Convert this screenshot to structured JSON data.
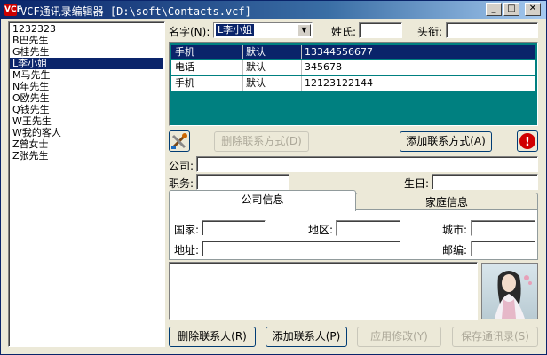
{
  "window": {
    "title": "VCF通讯录编辑器 [D:\\soft\\Contacts.vcf]",
    "app_icon": "VCF"
  },
  "titlebar_buttons": {
    "minimize": "_",
    "maximize": "□",
    "close": "✕"
  },
  "contacts": [
    {
      "label": "1232323"
    },
    {
      "label": "B巴先生"
    },
    {
      "label": "G桂先生"
    },
    {
      "label": "L李小姐",
      "selected": true
    },
    {
      "label": "M马先生"
    },
    {
      "label": "N年先生"
    },
    {
      "label": "O欧先生"
    },
    {
      "label": "Q钱先生"
    },
    {
      "label": "W王先生"
    },
    {
      "label": "W我的客人"
    },
    {
      "label": "Z曾女士"
    },
    {
      "label": "Z张先生"
    }
  ],
  "form": {
    "name_label": "名字(N):",
    "name_value": "L李小姐",
    "surname_label": "姓氏:",
    "surname_value": "",
    "title_label": "头衔:",
    "title_value": "",
    "company_label": "公司:",
    "company_value": "",
    "position_label": "职务:",
    "position_value": "",
    "birthday_label": "生日:",
    "birthday_value": ""
  },
  "phones": [
    {
      "type": "手机",
      "default": "默认",
      "number": "13344556677",
      "selected": true
    },
    {
      "type": "电话",
      "default": "默认",
      "number": "345678"
    },
    {
      "type": "手机",
      "default": "默认",
      "number": "12123122144"
    }
  ],
  "buttons": {
    "delete_contact_method": "删除联系方式(D)",
    "add_contact_method": "添加联系方式(A)",
    "delete_contact": "删除联系人(R)",
    "add_contact": "添加联系人(P)",
    "apply": "应用修改(Y)",
    "save": "保存通讯录(S)",
    "alert_glyph": "!"
  },
  "tabs": [
    {
      "label": "公司信息",
      "active": true
    },
    {
      "label": "家庭信息"
    }
  ],
  "company_info": {
    "country_label": "国家:",
    "country_value": "",
    "region_label": "地区:",
    "region_value": "",
    "city_label": "城市:",
    "city_value": "",
    "address_label": "地址:",
    "address_value": "",
    "postcode_label": "邮编:",
    "postcode_value": ""
  },
  "colors": {
    "selection": "#0a246a",
    "phone_list_bg": "#008080",
    "window_bg": "#ece9d8"
  }
}
